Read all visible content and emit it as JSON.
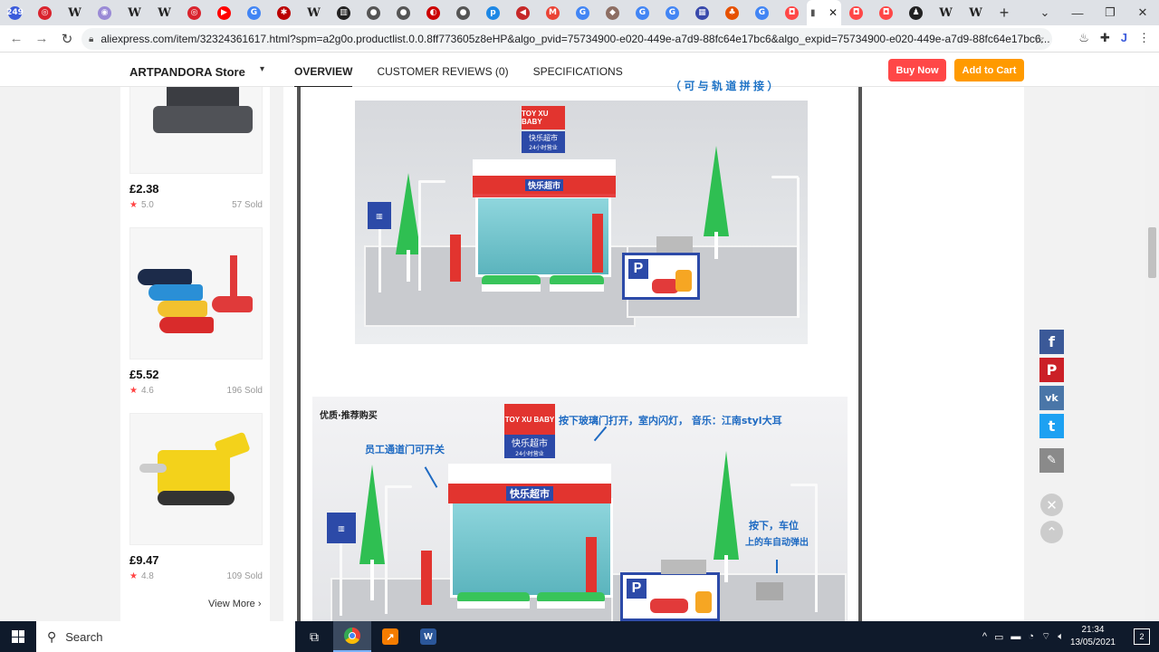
{
  "browser": {
    "tabs": [
      {
        "icon": "249",
        "color": "#3b5bdb"
      },
      {
        "icon": "◎",
        "color": "#d9232d"
      },
      {
        "icon": "W",
        "color": "w"
      },
      {
        "icon": "◉",
        "color": "#9a8ad6"
      },
      {
        "icon": "W",
        "color": "w"
      },
      {
        "icon": "W",
        "color": "w"
      },
      {
        "icon": "◎",
        "color": "#d9232d"
      },
      {
        "icon": "▶",
        "color": "#ff0000"
      },
      {
        "icon": "G",
        "color": "#4285f4"
      },
      {
        "icon": "✱",
        "color": "#b00"
      },
      {
        "icon": "W",
        "color": "w"
      },
      {
        "icon": "▥",
        "color": "#222"
      },
      {
        "icon": "●",
        "color": "#555"
      },
      {
        "icon": "●",
        "color": "#555"
      },
      {
        "icon": "◐",
        "color": "#c00"
      },
      {
        "icon": "●",
        "color": "#555"
      },
      {
        "icon": "p",
        "color": "#1e88e5"
      },
      {
        "icon": "◀",
        "color": "#c62828"
      },
      {
        "icon": "M",
        "color": "#ea4335"
      },
      {
        "icon": "G",
        "color": "#4285f4"
      },
      {
        "icon": "◆",
        "color": "#8d6e63"
      },
      {
        "icon": "G",
        "color": "#4285f4"
      },
      {
        "icon": "G",
        "color": "#4285f4"
      },
      {
        "icon": "▦",
        "color": "#3949ab"
      },
      {
        "icon": "♣",
        "color": "#e65100"
      },
      {
        "icon": "G",
        "color": "#4285f4"
      },
      {
        "icon": "◘",
        "color": "#ff4747"
      }
    ],
    "active_tab_icon": "▮",
    "after_tabs": [
      {
        "icon": "◘",
        "color": "#ff4747"
      },
      {
        "icon": "◘",
        "color": "#ff4747"
      },
      {
        "icon": "♟",
        "color": "#222"
      },
      {
        "icon": "W",
        "color": "w"
      },
      {
        "icon": "W",
        "color": "w"
      }
    ],
    "url": "aliexpress.com/item/32324361617.html?spm=a2g0o.productlist.0.0.8ff773605z8eHP&algo_pvid=75734900-e020-449e-a7d9-88fc64e17bc6&algo_expid=75734900-e020-449e-a7d9-88fc64e17bc6..."
  },
  "header": {
    "store_name": "ARTPANDORA Store",
    "tabs": [
      "OVERVIEW",
      "CUSTOMER REVIEWS (0)",
      "SPECIFICATIONS"
    ],
    "buy_now": "Buy Now",
    "add_to_cart": "Add to Cart"
  },
  "sidebar": {
    "products": [
      {
        "price": "£2.38",
        "rating": "5.0",
        "sold": "57 Sold"
      },
      {
        "price": "£5.52",
        "rating": "4.6",
        "sold": "196 Sold"
      },
      {
        "price": "£9.47",
        "rating": "4.8",
        "sold": "109 Sold"
      }
    ],
    "view_more": "View More"
  },
  "description": {
    "top_caption": "（ 可 与 轨 道 拼 接 ）",
    "pic1": {
      "logo": "TOY XU BABY",
      "store_sign": "快乐超市",
      "store_sign_sub": "24小时营业",
      "parking_p": "P"
    },
    "pic2": {
      "corner_text": "优质·推荐购买",
      "logo": "TOY XU BABY",
      "sign": "快乐超市",
      "sign_sub": "24小时营业",
      "anno_top": "按下玻璃门打开，室内闪灯， 音乐：江南styl大耳",
      "anno_left": "员工通道门可开关",
      "anno_right_1": "按下，车位",
      "anno_right_2": "上的车自动弹出",
      "parking_p": "P"
    }
  },
  "social": [
    "f",
    "P",
    "vk",
    "t",
    "✎"
  ],
  "taskbar": {
    "search_label": "Search",
    "time": "21:34",
    "date": "13/05/2021",
    "notifications": "2"
  }
}
